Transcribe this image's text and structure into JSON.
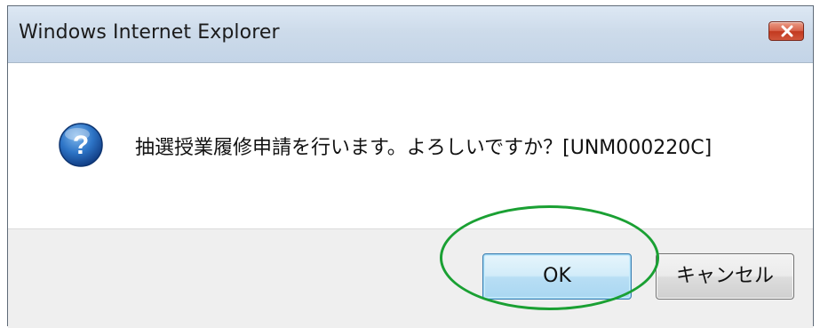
{
  "window": {
    "title": "Windows Internet Explorer",
    "close_icon": "close-icon"
  },
  "dialog": {
    "icon": "question-icon",
    "message": "抽選授業履修申請を行います。よろしいですか？[UNM000220C]"
  },
  "buttons": {
    "ok_label": "OK",
    "cancel_label": "キャンセル"
  },
  "annotation": {
    "highlight_color": "#1aa033",
    "highlight_target": "ok-button"
  },
  "colors": {
    "close_button": "#c2391f",
    "ok_button_border": "#3c7fb1",
    "icon_blue": "#1b5fa8"
  }
}
